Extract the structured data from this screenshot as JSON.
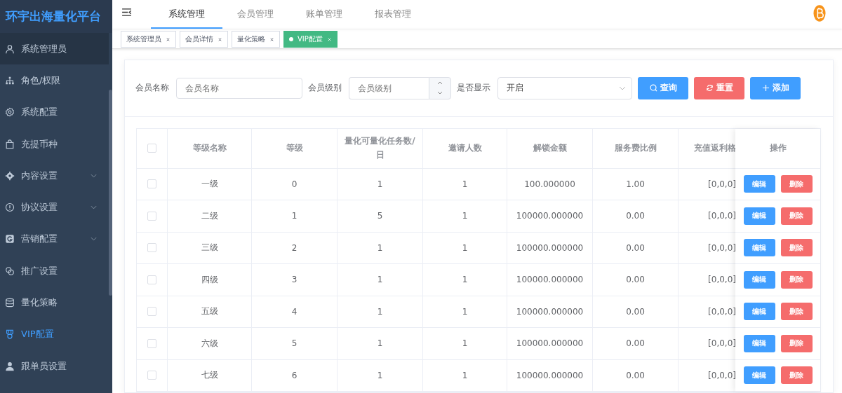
{
  "brand": "环宇出海量化平台",
  "sidebar": {
    "items": [
      {
        "label": "系统管理员",
        "selected": false,
        "hovered": true,
        "expandable": false
      },
      {
        "label": "角色/权限",
        "selected": false,
        "hovered": false,
        "expandable": false
      },
      {
        "label": "系统配置",
        "selected": false,
        "hovered": false,
        "expandable": false
      },
      {
        "label": "充提币种",
        "selected": false,
        "hovered": false,
        "expandable": false
      },
      {
        "label": "内容设置",
        "selected": false,
        "hovered": false,
        "expandable": true
      },
      {
        "label": "协议设置",
        "selected": false,
        "hovered": false,
        "expandable": true
      },
      {
        "label": "营销配置",
        "selected": false,
        "hovered": false,
        "expandable": true
      },
      {
        "label": "推广设置",
        "selected": false,
        "hovered": false,
        "expandable": false
      },
      {
        "label": "量化策略",
        "selected": false,
        "hovered": false,
        "expandable": false
      },
      {
        "label": "VIP配置",
        "selected": true,
        "hovered": false,
        "expandable": false
      },
      {
        "label": "跟单员设置",
        "selected": false,
        "hovered": false,
        "expandable": false
      }
    ]
  },
  "top_tabs": [
    {
      "label": "系统管理",
      "selected": true
    },
    {
      "label": "会员管理",
      "selected": false
    },
    {
      "label": "账单管理",
      "selected": false
    },
    {
      "label": "报表管理",
      "selected": false
    }
  ],
  "tags": [
    {
      "label": "系统管理员",
      "selected": false
    },
    {
      "label": "会员详情",
      "selected": false
    },
    {
      "label": "量化策略",
      "selected": false
    },
    {
      "label": "VIP配置",
      "selected": true
    }
  ],
  "filters": {
    "name_label": "会员名称",
    "name_placeholder": "会员名称",
    "level_label": "会员级别",
    "level_placeholder": "会员级别",
    "show_label": "是否显示",
    "show_value": "开启"
  },
  "buttons": [
    {
      "label": "查询",
      "kind": "search"
    },
    {
      "label": "重置",
      "kind": "reset"
    },
    {
      "label": "添加",
      "kind": "add"
    }
  ],
  "table": {
    "select_all_checked": false,
    "columns": [
      "等级名称",
      "等级",
      "量化可量化任务数/日",
      "邀请人数",
      "解锁金额",
      "服务费比例",
      "充值返利格",
      "操作"
    ],
    "rows": [
      {
        "checked": false,
        "cells": [
          "一级",
          "0",
          "1",
          "1",
          "100.000000",
          "1.00",
          "[0,0,0]"
        ],
        "actions": [
          "编辑",
          "删除"
        ]
      },
      {
        "checked": false,
        "cells": [
          "二级",
          "1",
          "5",
          "1",
          "100000.000000",
          "0.00",
          "[0,0,0]"
        ],
        "actions": [
          "编辑",
          "删除"
        ]
      },
      {
        "checked": false,
        "cells": [
          "三级",
          "2",
          "1",
          "1",
          "100000.000000",
          "0.00",
          "[0,0,0]"
        ],
        "actions": [
          "编辑",
          "删除"
        ]
      },
      {
        "checked": false,
        "cells": [
          "四级",
          "3",
          "1",
          "1",
          "100000.000000",
          "0.00",
          "[0,0,0]"
        ],
        "actions": [
          "编辑",
          "删除"
        ]
      },
      {
        "checked": false,
        "cells": [
          "五级",
          "4",
          "1",
          "1",
          "100000.000000",
          "0.00",
          "[0,0,0]"
        ],
        "actions": [
          "编辑",
          "删除"
        ]
      },
      {
        "checked": false,
        "cells": [
          "六级",
          "5",
          "1",
          "1",
          "100000.000000",
          "0.00",
          "[0,0,0]"
        ],
        "actions": [
          "编辑",
          "删除"
        ]
      },
      {
        "checked": false,
        "cells": [
          "七级",
          "6",
          "1",
          "1",
          "100000.000000",
          "0.00",
          "[0,0,0]"
        ],
        "actions": [
          "编辑",
          "删除"
        ]
      }
    ]
  }
}
